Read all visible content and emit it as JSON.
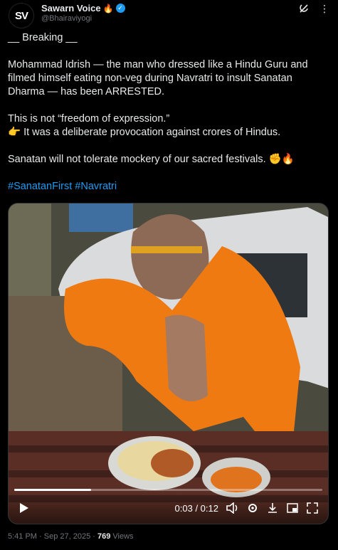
{
  "account": {
    "avatar_text": "SV",
    "display_name": "Sawarn Voice",
    "name_emoji": "🔥",
    "verified_glyph": "✓",
    "handle": "@Bhairaviyogi"
  },
  "tweet": {
    "line1": "__ Breaking __",
    "line2": "Mohammad Idrish — the man who dressed like a Hindu Guru and filmed himself eating non-veg during Navratri to insult Sanatan Dharma — has been ARRESTED.",
    "line3": "This is not “freedom of expression.”",
    "line4": "👉 It was a deliberate provocation against crores of Hindus.",
    "line5": "Sanatan will not tolerate mockery of our sacred festivals. ✊🔥",
    "hashtags": [
      "#SanatanFirst",
      "#Navratri"
    ]
  },
  "video": {
    "time_display": "0:03 / 0:12",
    "progress_fraction": 0.25,
    "play_icon": "play-icon",
    "volume_icon": "volume-icon",
    "settings_icon": "settings-icon",
    "download_icon": "download-icon",
    "pip_icon": "picture-in-picture-icon",
    "fullscreen_icon": "fullscreen-icon"
  },
  "meta": {
    "timestamp": "5:41 PM · Sep 27, 2025 · ",
    "views_count": "769",
    "views_label": " Views"
  },
  "colors": {
    "background": "#000000",
    "text": "#e7e9ea",
    "secondary": "#71767b",
    "link": "#1d9bf0"
  }
}
